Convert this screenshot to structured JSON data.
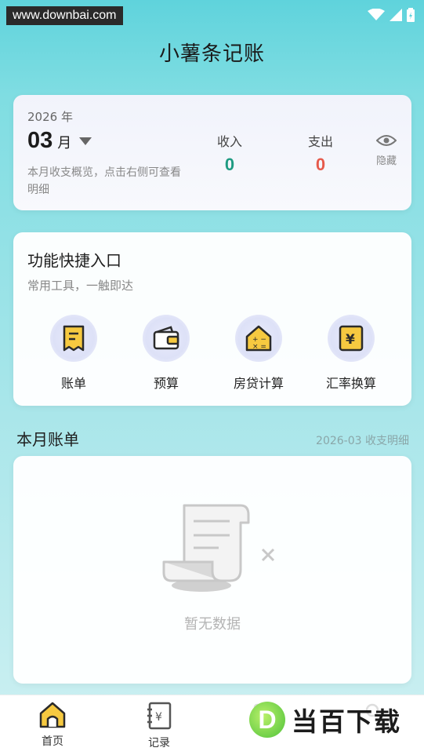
{
  "watermark_top": "www.downbai.com",
  "app": {
    "title": "小薯条记账"
  },
  "summary": {
    "year": "2026 年",
    "month": "03",
    "month_unit": "月",
    "description": "本月收支概览，点击右侧可查看明细",
    "income_label": "收入",
    "income_value": "0",
    "expense_label": "支出",
    "expense_value": "0",
    "hide_label": "隐藏",
    "income_color": "#1f9b82",
    "expense_color": "#e65a4c"
  },
  "tools": {
    "title": "功能快捷入口",
    "subtitle": "常用工具，一触即达",
    "items": [
      {
        "label": "账单",
        "icon": "receipt-icon"
      },
      {
        "label": "预算",
        "icon": "wallet-icon"
      },
      {
        "label": "房贷计算",
        "icon": "house-calculator-icon"
      },
      {
        "label": "汇率换算",
        "icon": "currency-yen-icon"
      }
    ]
  },
  "monthly_bills": {
    "title": "本月账单",
    "subtitle": "2026-03 收支明细",
    "empty_text": "暂无数据"
  },
  "tabbar": {
    "items": [
      {
        "label": "首页",
        "icon": "home-icon",
        "active": true
      },
      {
        "label": "记录",
        "icon": "ledger-icon",
        "active": false
      },
      {
        "label": "",
        "icon": "chart-icon",
        "active": false
      },
      {
        "label": "",
        "icon": "user-icon",
        "active": false
      }
    ]
  },
  "brand_watermark": {
    "badge": "D",
    "text": "当百下载"
  }
}
